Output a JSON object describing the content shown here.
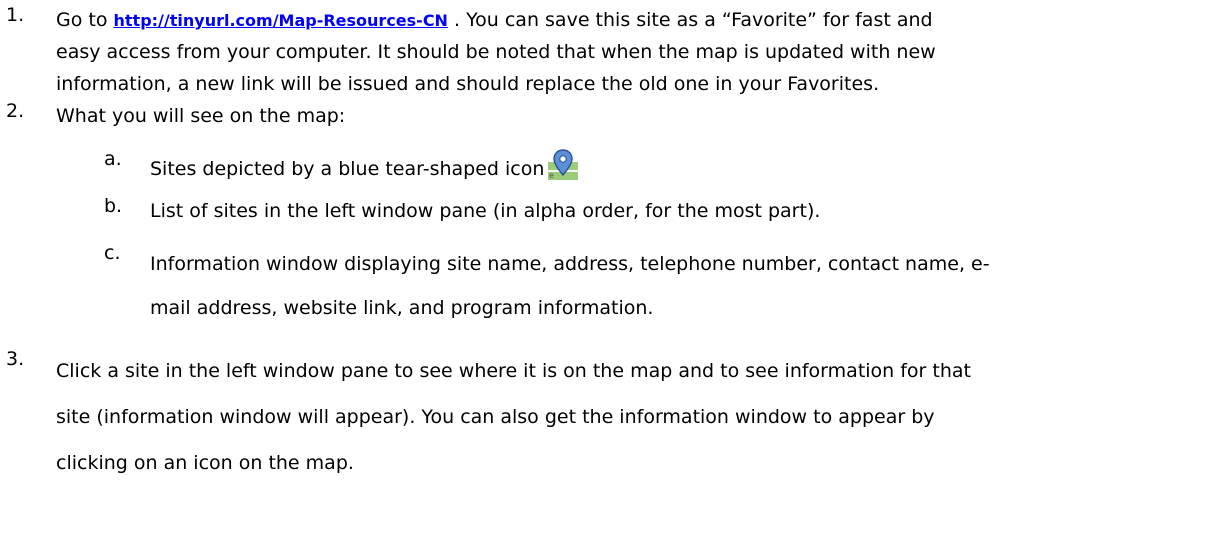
{
  "steps": [
    {
      "number": "1.",
      "before_link": "Go to ",
      "link": "http://tinyurl.com/Map-Resources-CN",
      "after_link": " . You can save this site as a “Favorite” for fast and",
      "lines": [
        "easy access from your computer. It should be noted that when the map is updated with new",
        "information, a new link will be issued and should replace the old one in your Favorites."
      ]
    },
    {
      "number": "2.",
      "lines": [
        "What you will see on the map:"
      ],
      "sub_items": [
        {
          "letter": "a.",
          "lines": [
            "Sites depicted by a blue tear-shaped icon"
          ],
          "icon": "map-pin-icon"
        },
        {
          "letter": "b.",
          "lines": [
            "List of sites in the left window pane (in alpha order, for the most part)."
          ]
        },
        {
          "letter": "c.",
          "lines": [
            "Information window displaying site name, address, telephone number, contact name, e-",
            "mail address, website link, and program information."
          ]
        }
      ]
    },
    {
      "number": "3.",
      "lines": [
        "Click a site in the left window pane to see where it is on the map and to see information for that",
        "site (information window will appear). You can also get the information window to appear by",
        "clicking on an icon on the map."
      ]
    }
  ],
  "colors": {
    "text": "#000000",
    "link": "#0000ff",
    "pin_fill": "#5b8fd6",
    "pin_stroke": "#2a4f96",
    "map_green": "#9ccc7a"
  }
}
